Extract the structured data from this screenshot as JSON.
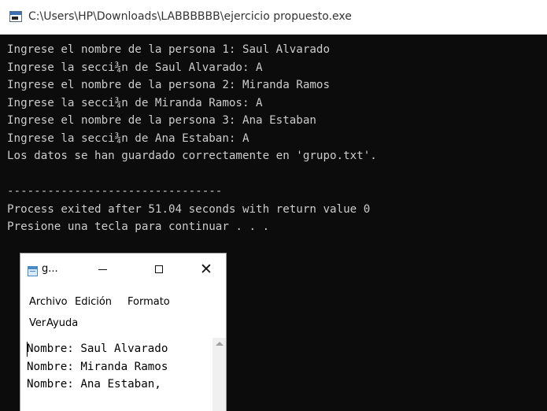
{
  "console": {
    "title": "C:\\Users\\HP\\Downloads\\LABBBBBB\\ejercicio propuesto.exe",
    "lines": [
      "Ingrese el nombre de la persona 1: Saul Alvarado",
      "Ingrese la secci¾n de Saul Alvarado: A",
      "Ingrese el nombre de la persona 2: Miranda Ramos",
      "Ingrese la secci¾n de Miranda Ramos: A",
      "Ingrese el nombre de la persona 3: Ana Estaban",
      "Ingrese la secci¾n de Ana Estaban: A",
      "Los datos se han guardado correctamente en 'grupo.txt'.",
      "",
      "--------------------------------",
      "Process exited after 51.04 seconds with return value 0",
      "Presione una tecla para continuar . . ."
    ],
    "colors": {
      "background": "#0c0c0c",
      "text": "#cccccc"
    }
  },
  "notepad": {
    "title": "g...",
    "controls": {
      "minimize": "—",
      "maximize": "☐",
      "close": "✕"
    },
    "menu": {
      "archivo": "Archivo",
      "edicion": "Edición",
      "formato": "Formato",
      "ver": "Ver",
      "ayuda": "Ayuda"
    },
    "lines": [
      "Nombre: Saul Alvarado",
      "Nombre: Miranda Ramos",
      "Nombre: Ana Estaban,"
    ]
  }
}
